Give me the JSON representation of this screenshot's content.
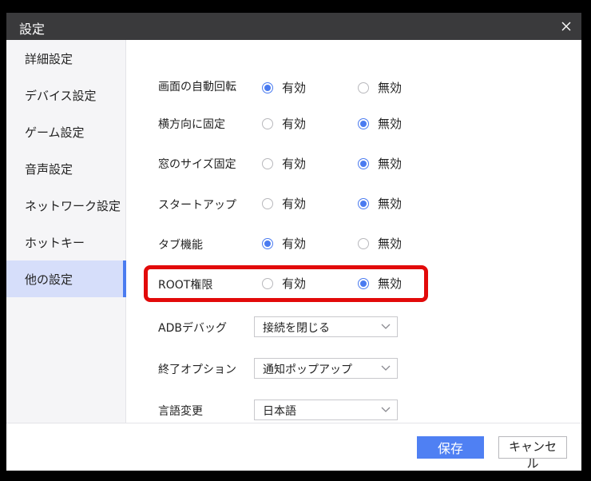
{
  "window": {
    "title": "設定"
  },
  "sidebar": {
    "items": [
      {
        "label": "詳細設定"
      },
      {
        "label": "デバイス設定"
      },
      {
        "label": "ゲーム設定"
      },
      {
        "label": "音声設定"
      },
      {
        "label": "ネットワーク設定"
      },
      {
        "label": "ホットキー"
      },
      {
        "label": "他の設定",
        "active": true
      }
    ]
  },
  "options": {
    "enabled_label": "有効",
    "disabled_label": "無効",
    "rows": [
      {
        "label": "画面の自動回転",
        "selected": "有効"
      },
      {
        "label": "横方向に固定",
        "selected": "無効"
      },
      {
        "label": "窓のサイズ固定",
        "selected": "無効"
      },
      {
        "label": "スタートアップ",
        "selected": "無効"
      },
      {
        "label": "タブ機能",
        "selected": "有効"
      },
      {
        "label": "ROOT権限",
        "selected": "無効"
      }
    ]
  },
  "dropdowns": [
    {
      "label": "ADBデバッグ",
      "value": "接続を閉じる"
    },
    {
      "label": "終了オプション",
      "value": "通知ポップアップ"
    },
    {
      "label": "言語変更",
      "value": "日本語"
    }
  ],
  "footer": {
    "save_label": "保存",
    "cancel_label": "キャンセル"
  },
  "colors": {
    "accent": "#4f80f3",
    "highlight_border": "#e20a0a",
    "titlebar": "#3a3a3c"
  }
}
